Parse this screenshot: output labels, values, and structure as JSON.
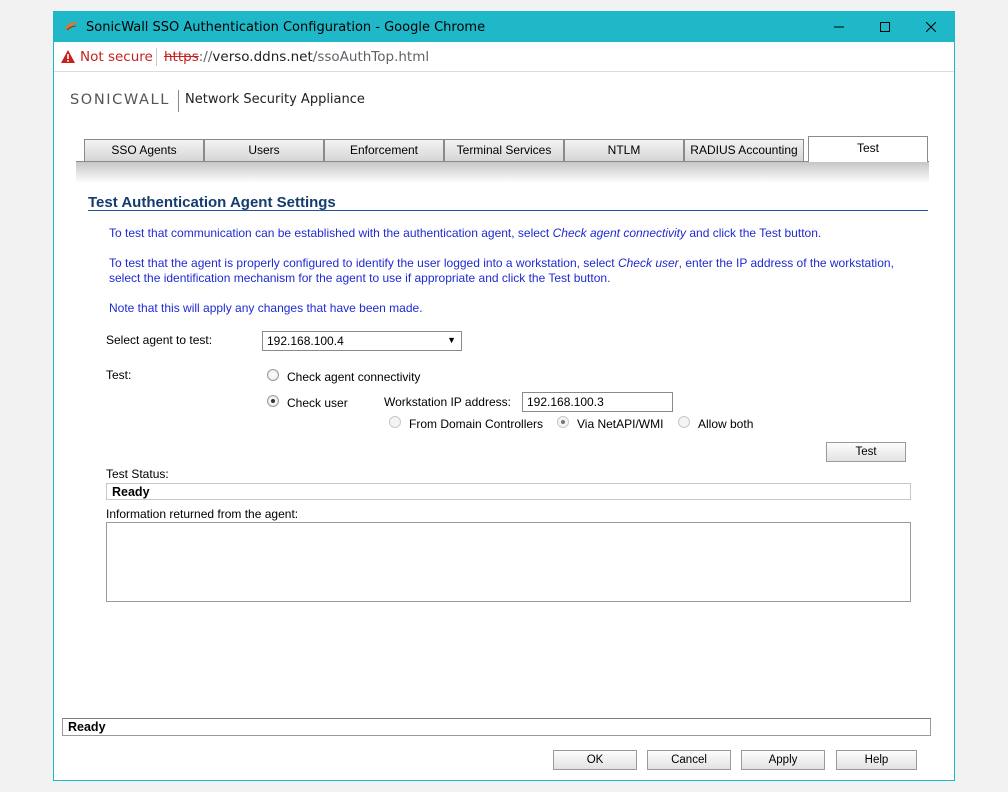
{
  "window": {
    "title": "SonicWall SSO Authentication Configuration - Google Chrome",
    "accent_color": "#1fb8c8"
  },
  "address_bar": {
    "security_label": "Not secure",
    "url_scheme": "https",
    "url_host": "verso.ddns.net",
    "url_path": "/ssoAuthTop.html"
  },
  "header": {
    "logo_brand": "SONICWALL",
    "product": "Network Security Appliance"
  },
  "tabs": [
    {
      "label": "SSO Agents"
    },
    {
      "label": "Users"
    },
    {
      "label": "Enforcement"
    },
    {
      "label": "Terminal Services"
    },
    {
      "label": "NTLM"
    },
    {
      "label": "RADIUS Accounting"
    },
    {
      "label": "Test",
      "active": true
    }
  ],
  "section": {
    "title": "Test Authentication Agent Settings",
    "info1_pre": "To test that communication can be established with the authentication agent, select ",
    "info1_em": "Check agent connectivity",
    "info1_post": " and click the Test button.",
    "info2_pre": "To test that the agent is properly configured to identify the user logged into a workstation, select ",
    "info2_em": "Check user",
    "info2_post": ", enter the IP address of the workstation, select the identification mechanism for the agent to use if appropriate and click the Test button.",
    "info3": "Note that this will apply any changes that have been made."
  },
  "form": {
    "agent_label": "Select agent to test:",
    "agent_value": "192.168.100.4",
    "test_label": "Test:",
    "option_connectivity": "Check agent connectivity",
    "option_check_user": "Check user",
    "workstation_label": "Workstation IP address:",
    "workstation_value": "192.168.100.3",
    "mech_dc": "From Domain Controllers",
    "mech_netapi": "Via NetAPI/WMI",
    "mech_both": "Allow both",
    "test_button": "Test",
    "status_label": "Test Status:",
    "status_value": "Ready",
    "info_label": "Information returned from the agent:"
  },
  "footer": {
    "status": "Ready",
    "ok": "OK",
    "cancel": "Cancel",
    "apply": "Apply",
    "help": "Help"
  }
}
